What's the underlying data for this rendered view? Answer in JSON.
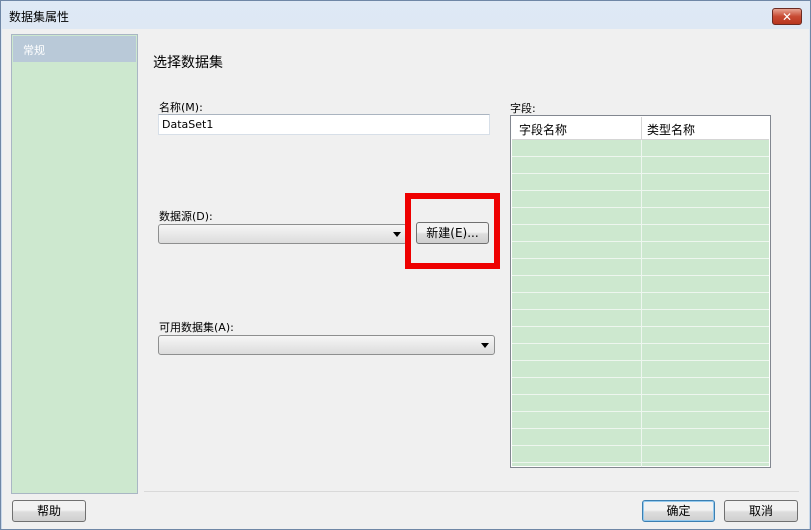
{
  "window": {
    "title": "数据集属性",
    "close_glyph": "✕"
  },
  "sidebar": {
    "items": [
      {
        "label": "常规"
      }
    ]
  },
  "page": {
    "title": "选择数据集"
  },
  "form": {
    "name_label": "名称(M):",
    "name_value": "DataSet1",
    "datasource_label": "数据源(D):",
    "datasource_value": "",
    "new_button": "新建(E)...",
    "available_label": "可用数据集(A):",
    "available_value": ""
  },
  "fields": {
    "label": "字段:",
    "columns": [
      "字段名称",
      "类型名称"
    ],
    "rows": []
  },
  "footer": {
    "help": "帮助",
    "ok": "确定",
    "cancel": "取消"
  },
  "colors": {
    "sidebar_bg": "#cde8cf",
    "grid_bg": "#cde8cf",
    "highlight": "#ee0000"
  }
}
